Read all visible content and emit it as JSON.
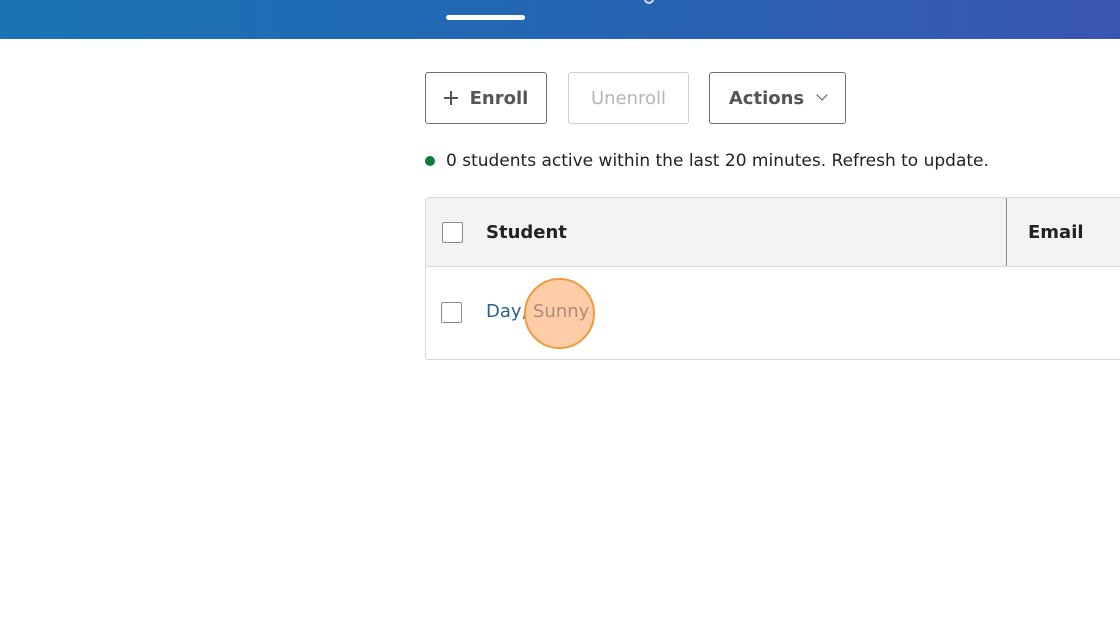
{
  "toolbar": {
    "enroll_label": "Enroll",
    "unenroll_label": "Unenroll",
    "actions_label": "Actions"
  },
  "status": {
    "text": "0 students active within the last 20 minutes. Refresh to update.",
    "dot_color": "#0c7c3d"
  },
  "table": {
    "columns": [
      "Student",
      "Email"
    ],
    "rows": [
      {
        "student": "Day, Sunny"
      }
    ]
  },
  "colors": {
    "banner_start": "#1a73b5",
    "banner_end": "#3a55b0",
    "link": "#2b5f8f",
    "click_marker": "#f09a3e"
  },
  "icons": {
    "enroll": "plus-icon",
    "actions": "chevron-down-icon"
  }
}
